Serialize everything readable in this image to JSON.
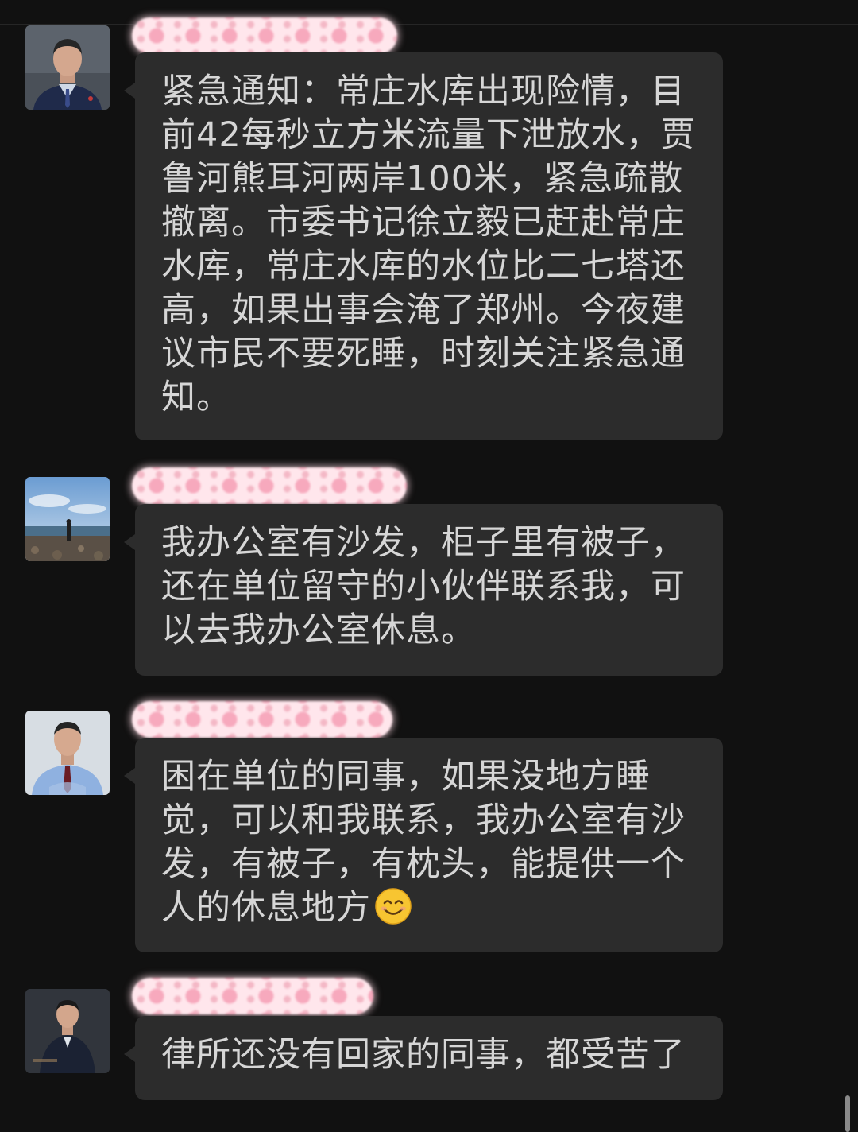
{
  "chat": {
    "messages": [
      {
        "text": "紧急通知：常庄水库出现险情，目前42每秒立方米流量下泄放水，贾鲁河熊耳河两岸100米，紧急疏散撤离。市委书记徐立毅已赶赴常庄水库，常庄水库的水位比二七塔还高，如果出事会淹了郑州。今夜建议市民不要死睡，时刻关注紧急通知。"
      },
      {
        "text": "我办公室有沙发，柜子里有被子，还在单位留守的小伙伴联系我，可以去我办公室休息。"
      },
      {
        "text": "困在单位的同事，如果没地方睡觉，可以和我联系，我办公室有沙发，有被子，有枕头，能提供一个人的休息地方",
        "emoji": "smiling-face-emoji"
      },
      {
        "text": "律所还没有回家的同事，都受苦了"
      }
    ]
  },
  "colors": {
    "background": "#111111",
    "bubble": "#2c2c2c",
    "text": "#d6d6d6",
    "name_blur_pink": "#f7a9bd"
  }
}
